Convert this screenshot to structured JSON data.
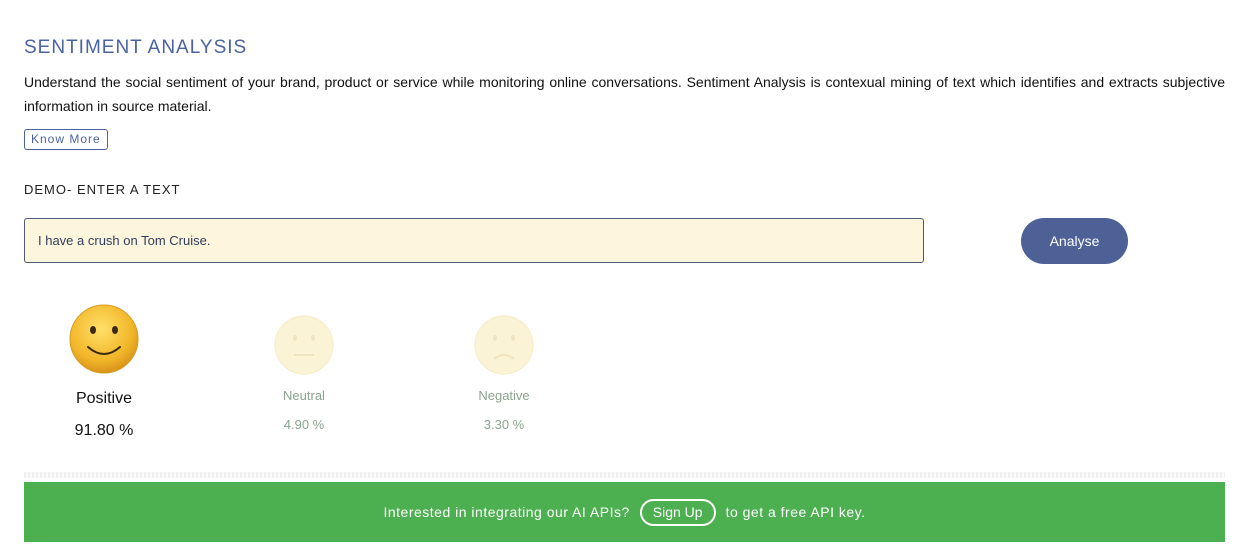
{
  "header": {
    "title": "SENTIMENT ANALYSIS",
    "description": "Understand the social sentiment of your brand, product or service while monitoring online conversations. Sentiment Analysis is contexual mining of text which identifies and extracts subjective information in source material.",
    "know_more_label": "Know More"
  },
  "demo": {
    "label": "DEMO- ENTER A TEXT",
    "input_value": "I have a crush on Tom Cruise.",
    "analyse_label": "Analyse"
  },
  "results": [
    {
      "label": "Positive",
      "percent": "91.80 %",
      "icon": "happy-face-icon",
      "active": true
    },
    {
      "label": "Neutral",
      "percent": "4.90 %",
      "icon": "neutral-face-icon",
      "active": false
    },
    {
      "label": "Negative",
      "percent": "3.30 %",
      "icon": "sad-face-icon",
      "active": false
    }
  ],
  "banner": {
    "text_before": "Interested in integrating our AI APIs?",
    "signup_label": "Sign Up",
    "text_after": "to get a free API key."
  },
  "colors": {
    "title": "#4a63a0",
    "button": "#4d6196",
    "input_bg": "#fdf6dc",
    "banner": "#4caf50",
    "active_face": "#f0b428",
    "faded_face": "#fbf3d6",
    "faded_text": "#8aa38e"
  }
}
